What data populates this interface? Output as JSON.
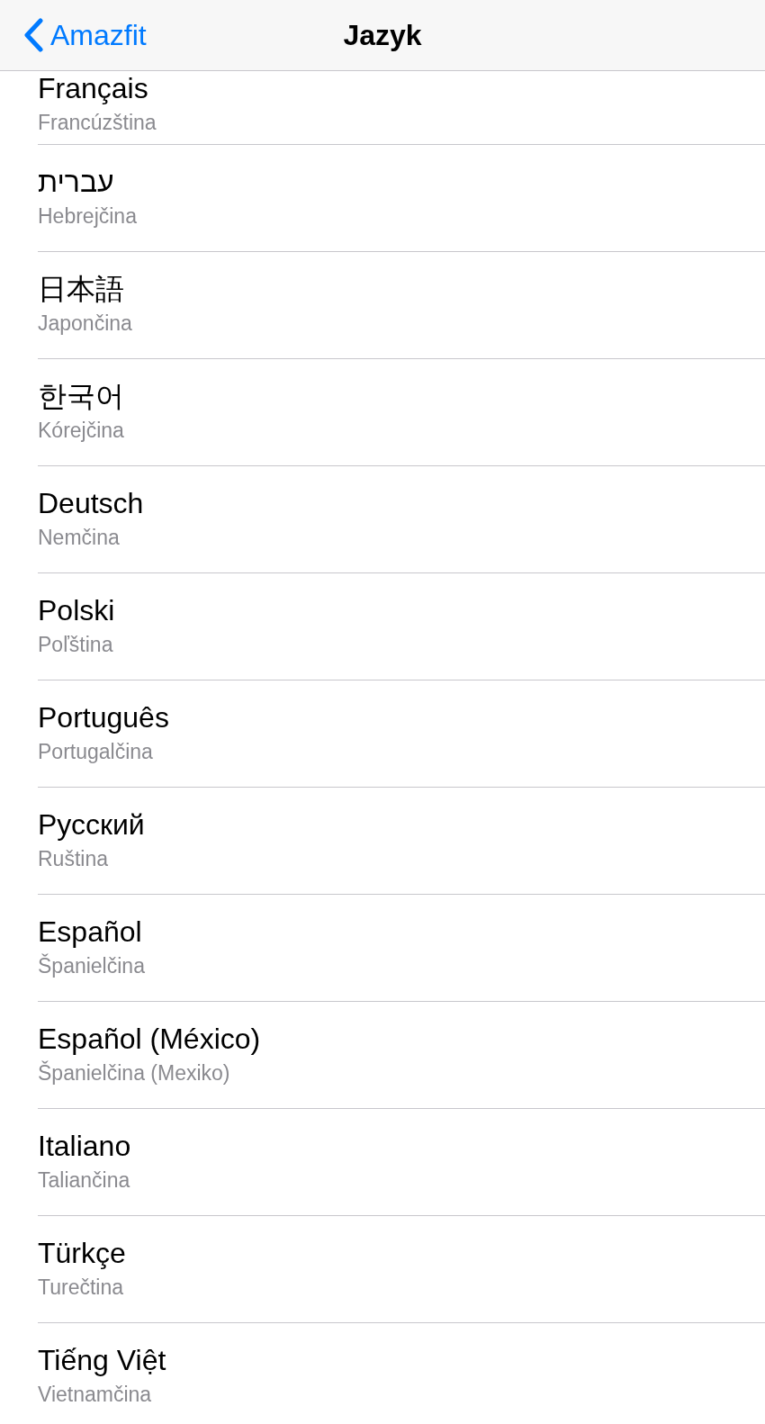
{
  "nav_bar": {
    "back_label": "Amazfit",
    "title": "Jazyk"
  },
  "languages": [
    {
      "name": "Français",
      "translation": "Francúzština"
    },
    {
      "name": "עברית",
      "translation": "Hebrejčina"
    },
    {
      "name": "日本語",
      "translation": "Japončina"
    },
    {
      "name": "한국어",
      "translation": "Kórejčina"
    },
    {
      "name": "Deutsch",
      "translation": "Nemčina"
    },
    {
      "name": "Polski",
      "translation": "Poľština"
    },
    {
      "name": "Português",
      "translation": "Portugalčina"
    },
    {
      "name": "Русский",
      "translation": "Ruština"
    },
    {
      "name": "Español",
      "translation": "Španielčina"
    },
    {
      "name": "Español (México)",
      "translation": "Španielčina (Mexiko)"
    },
    {
      "name": "Italiano",
      "translation": "Taliančina"
    },
    {
      "name": "Türkçe",
      "translation": "Turečtina"
    },
    {
      "name": "Tiếng Việt",
      "translation": "Vietnamčina"
    }
  ]
}
